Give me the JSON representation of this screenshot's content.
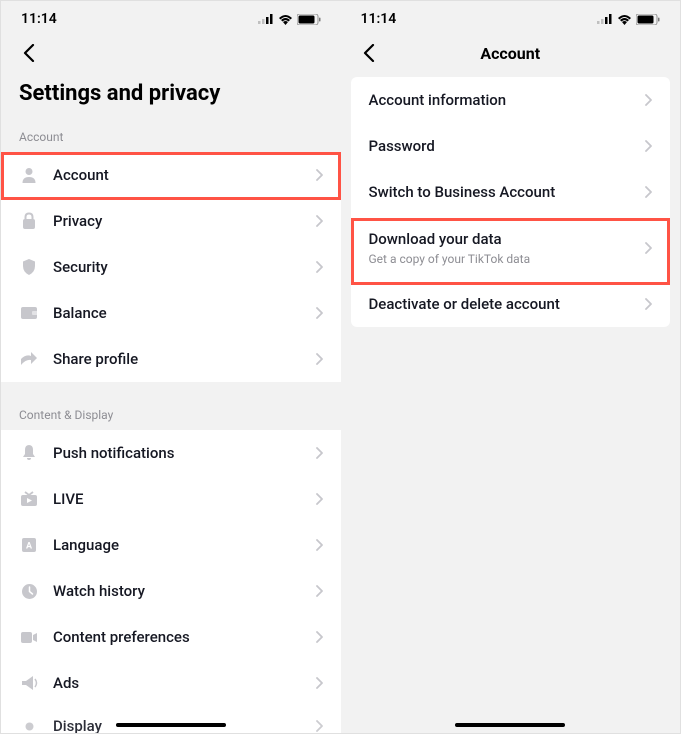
{
  "status": {
    "time": "11:14"
  },
  "left": {
    "title": "Settings and privacy",
    "section_account": "Account",
    "section_content": "Content & Display",
    "items_account": [
      {
        "icon": "person",
        "label": "Account",
        "highlighted": true
      },
      {
        "icon": "lock",
        "label": "Privacy"
      },
      {
        "icon": "shield",
        "label": "Security"
      },
      {
        "icon": "wallet",
        "label": "Balance"
      },
      {
        "icon": "share",
        "label": "Share profile"
      }
    ],
    "items_content": [
      {
        "icon": "bell",
        "label": "Push notifications"
      },
      {
        "icon": "tv",
        "label": "LIVE"
      },
      {
        "icon": "language",
        "label": "Language"
      },
      {
        "icon": "clock",
        "label": "Watch history"
      },
      {
        "icon": "video",
        "label": "Content preferences"
      },
      {
        "icon": "megaphone",
        "label": "Ads"
      },
      {
        "icon": "display",
        "label": "Display"
      }
    ]
  },
  "right": {
    "title": "Account",
    "items": [
      {
        "label": "Account information"
      },
      {
        "label": "Password"
      },
      {
        "label": "Switch to Business Account"
      },
      {
        "label": "Download your data",
        "sublabel": "Get a copy of your TikTok data",
        "highlighted": true
      },
      {
        "label": "Deactivate or delete account"
      }
    ]
  }
}
